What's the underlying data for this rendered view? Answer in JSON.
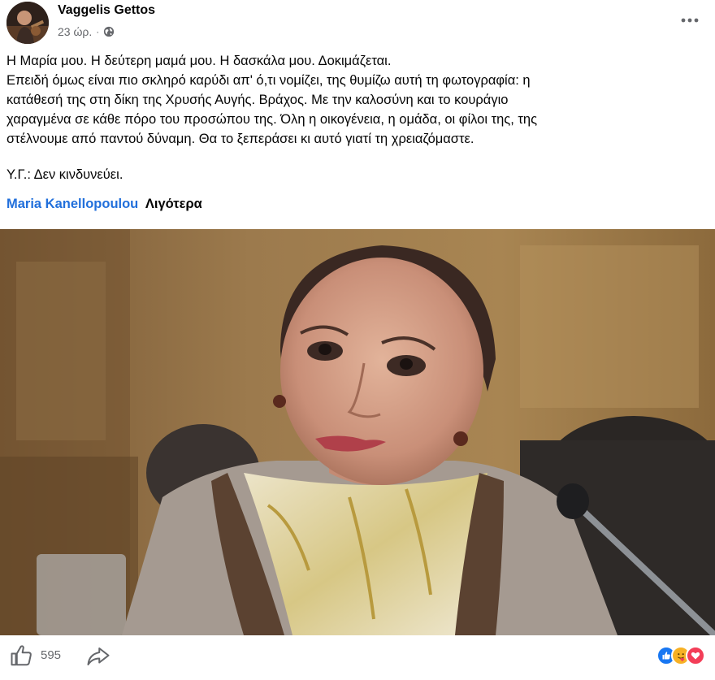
{
  "post": {
    "author": "Vaggelis Gettos",
    "time": "23 ώρ.",
    "separator": "·",
    "privacy_icon": "globe-icon",
    "more_icon": "more-dots-icon"
  },
  "content": {
    "line1": "Η Μαρία μου. Η δεύτερη μαμά μου. Η δασκάλα μου. Δοκιμάζεται.",
    "paragraph": "Επειδή όμως είναι πιο σκληρό καρύδι απ' ό,τι νομίζει, της θυμίζω αυτή τη φωτογραφία: η\nκατάθεσή της στη δίκη της Χρυσής Αυγής. Βράχος. Με την καλοσύνη και το κουράγιο\nχαραγμένα σε κάθε πόρο του προσώπου της. Όλη η οικογένεια, η ομάδα, οι φίλοι της, της\nστέλνουμε από παντού δύναμη. Θα το ξεπεράσει κι αυτό γιατί τη χρειαζόμαστε.",
    "ps": "Υ.Γ.: Δεν κινδυνεύει.",
    "tag": "Maria Kanellopoulou",
    "see_more": "Λιγότερα"
  },
  "footer": {
    "like_icon": "thumbs-up-icon",
    "like_count": "595",
    "share_icon": "share-arrow-icon",
    "reactions": [
      "like",
      "care",
      "love"
    ]
  },
  "colors": {
    "link_blue": "#216fdb",
    "meta_gray": "#65676b",
    "like_blue": "#1877f2",
    "love_red": "#f33e58",
    "care_yellow": "#f7b125"
  }
}
